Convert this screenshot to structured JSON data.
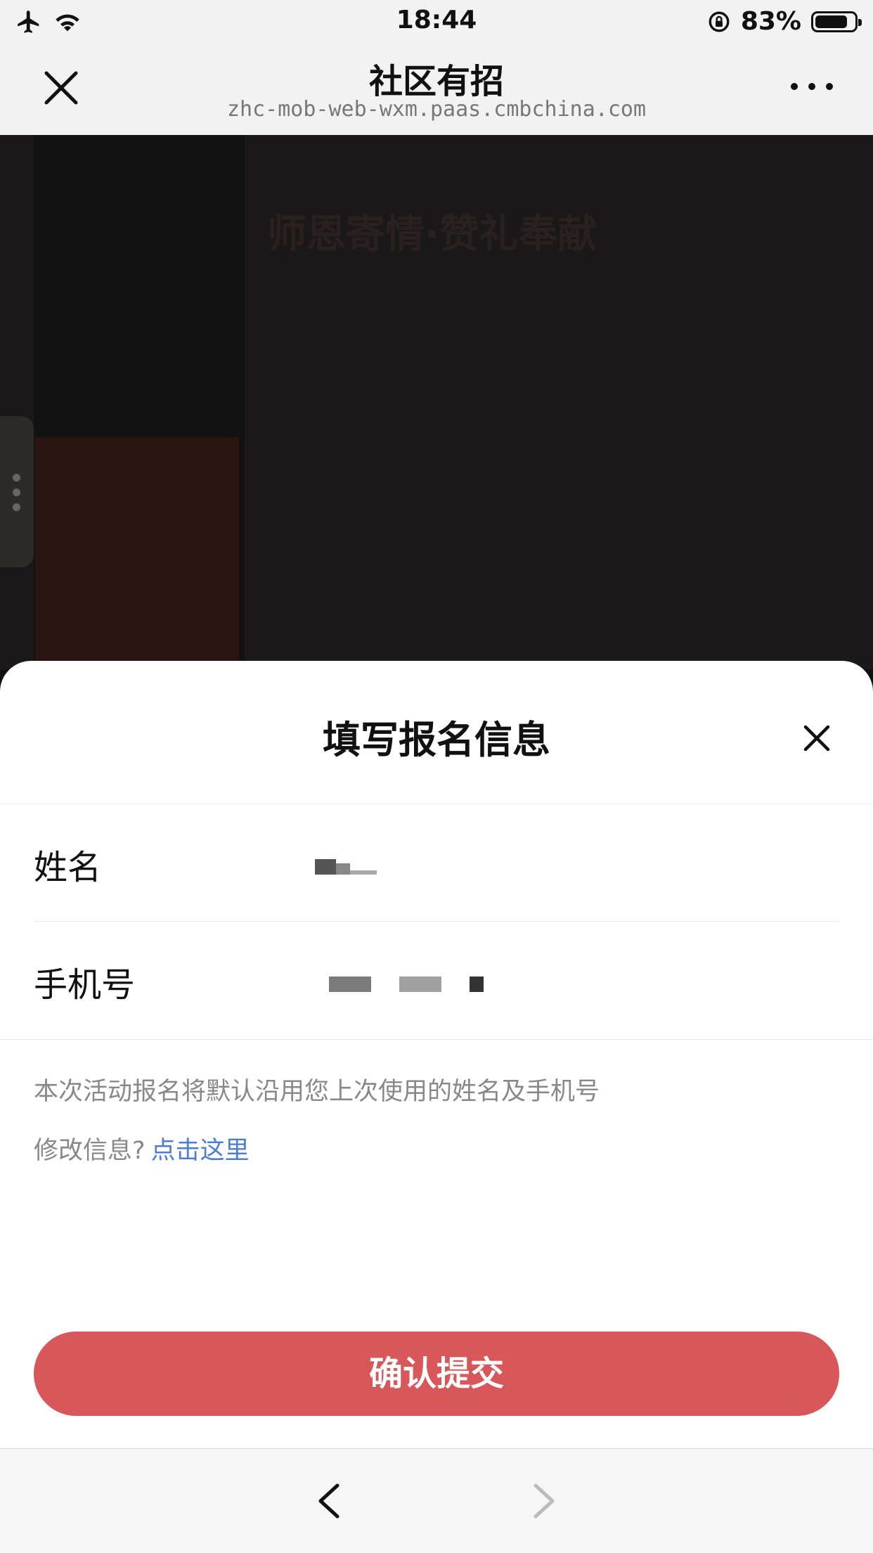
{
  "status_bar": {
    "time": "18:44",
    "battery_percent": "83%",
    "battery_level": 0.83,
    "icons": [
      "airplane-icon",
      "wifi-icon",
      "rotation-lock-icon",
      "battery-icon"
    ]
  },
  "nav": {
    "title": "社区有招",
    "url": "zhc-mob-web-wxm.paas.cmbchina.com"
  },
  "background_page": {
    "heading": "师恩寄情·赞礼奉献"
  },
  "sheet": {
    "title": "填写报名信息",
    "fields": [
      {
        "label": "姓名",
        "value": ""
      },
      {
        "label": "手机号",
        "value": ""
      }
    ],
    "note": "本次活动报名将默认沿用您上次使用的姓名及手机号",
    "edit_prompt": "修改信息?",
    "edit_link": "点击这里",
    "submit_label": "确认提交"
  },
  "toolbar": {
    "back": "back-icon",
    "forward": "forward-icon"
  },
  "colors": {
    "accent_red": "#d8575a",
    "link_blue": "#4d7ed6"
  }
}
